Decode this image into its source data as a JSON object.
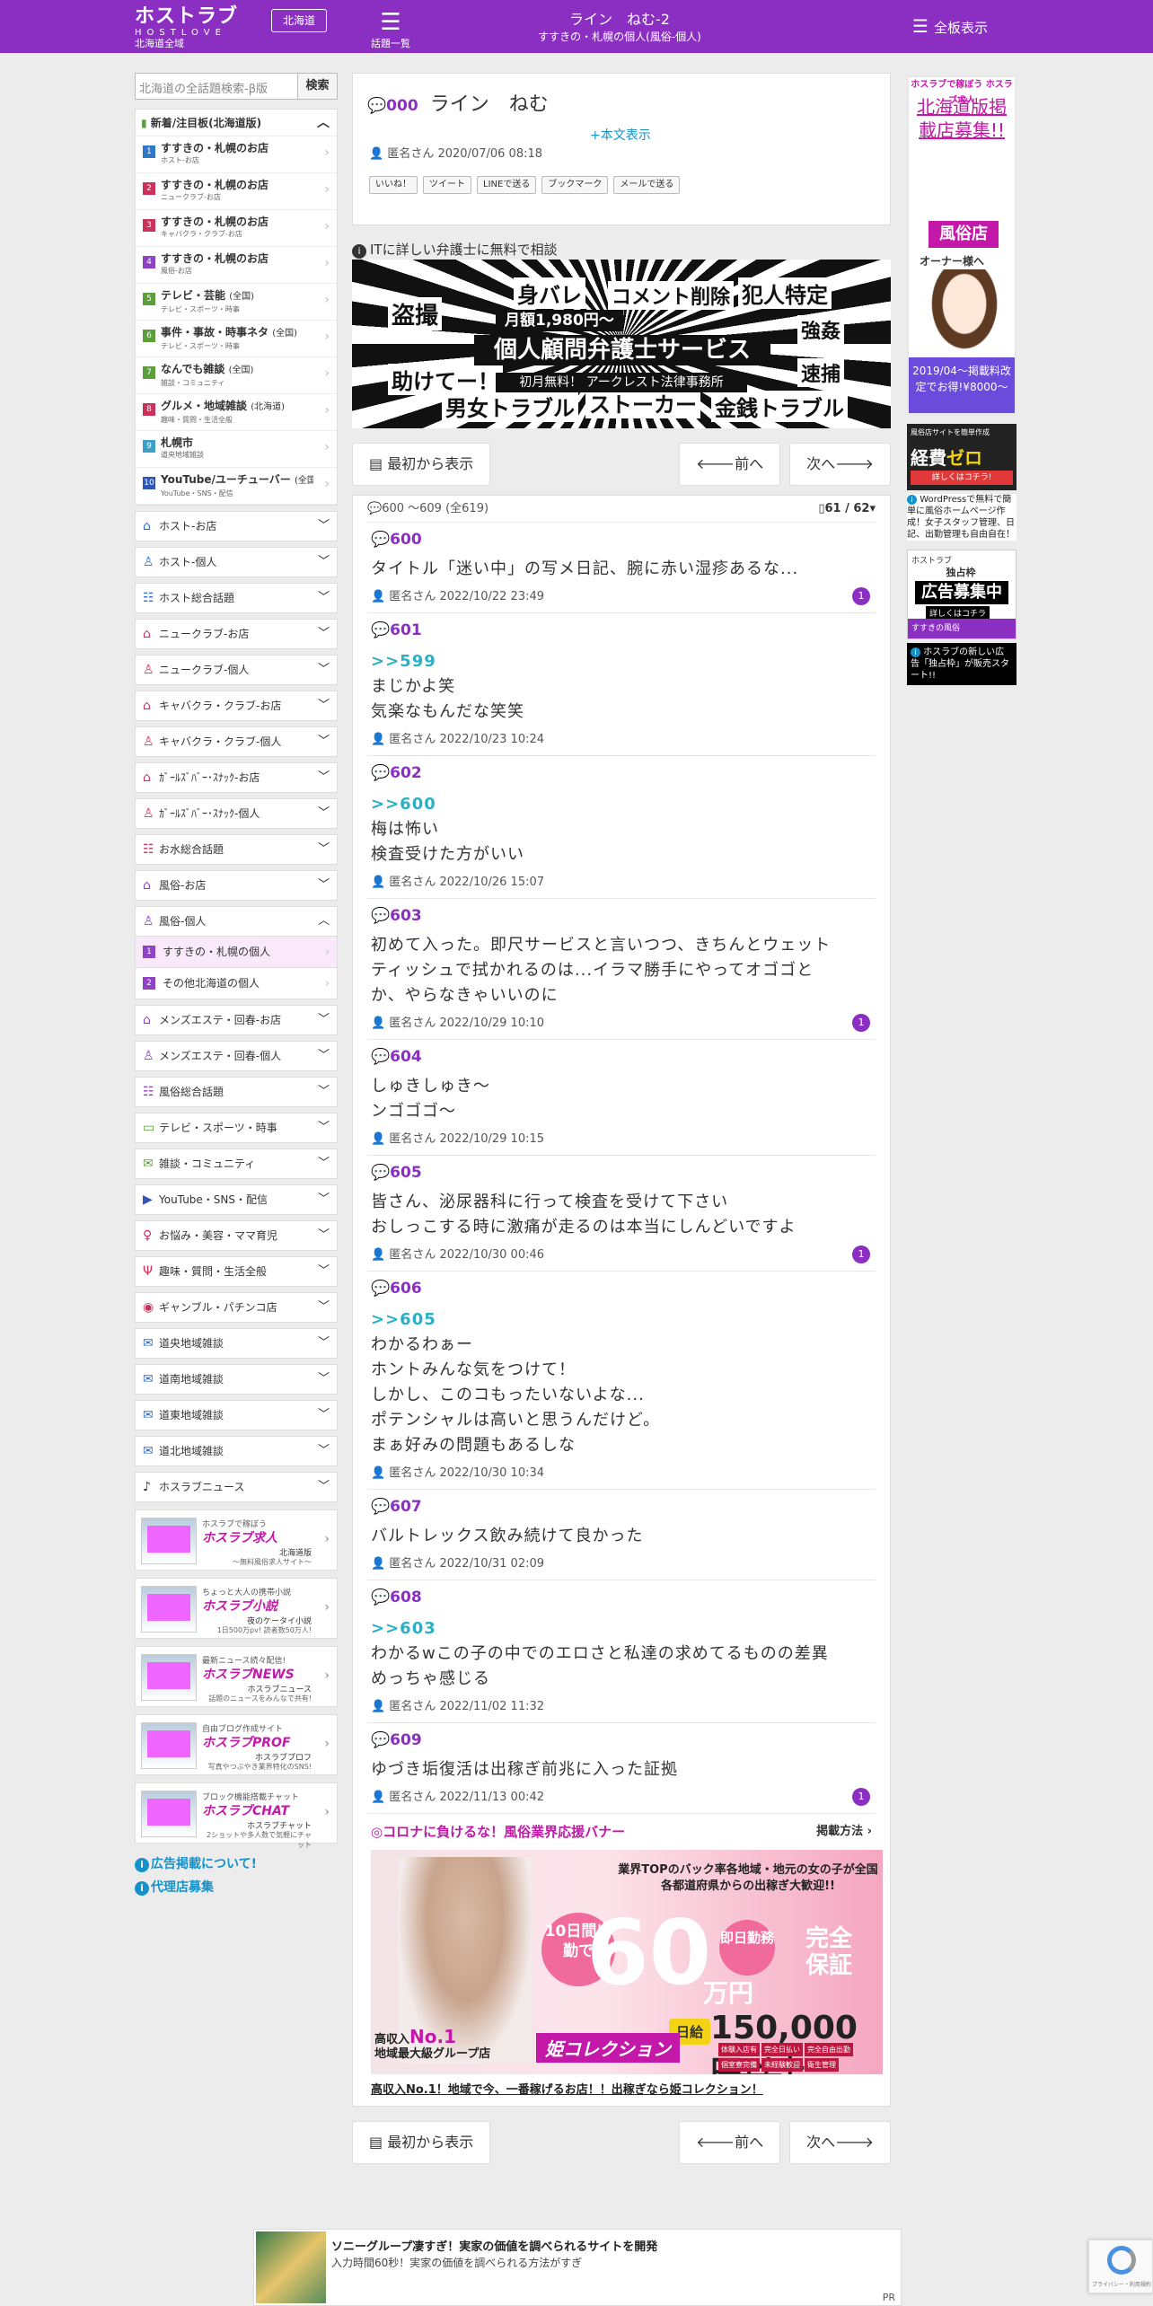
{
  "header": {
    "logo_main": "ホストラブ",
    "logo_sub": "HOSTLOVE",
    "logo_area": "北海道全域",
    "area_button": "北海道",
    "menu_icon_label": "話題一覧",
    "title": "ライン　ねむ-2",
    "subtitle": "すすきの・札幌の個人(風俗-個人)",
    "all_boards": "全板表示"
  },
  "sidebar": {
    "search_placeholder": "北海道の全話題検索-β版",
    "search_button": "検索",
    "new_boards_title": "新着/注目板(北海道版)",
    "boards": [
      {
        "num": "1",
        "color": "#3079c6",
        "title": "すすきの・札幌のお店",
        "small": "",
        "sub": "ホスト-お店"
      },
      {
        "num": "2",
        "color": "#c9335b",
        "title": "すすきの・札幌のお店",
        "small": "",
        "sub": "ニュークラブ-お店"
      },
      {
        "num": "3",
        "color": "#c9335b",
        "title": "すすきの・札幌のお店",
        "small": "",
        "sub": "キャバクラ・クラブ-お店"
      },
      {
        "num": "4",
        "color": "#8f42c4",
        "title": "すすきの・札幌のお店",
        "small": "",
        "sub": "風俗-お店"
      },
      {
        "num": "5",
        "color": "#5b9e3c",
        "title": "テレビ・芸能",
        "small": "(全国)",
        "sub": "テレビ・スポーツ・時事"
      },
      {
        "num": "6",
        "color": "#5b9e3c",
        "title": "事件・事故・時事ネタ",
        "small": "(全国)",
        "sub": "テレビ・スポーツ・時事"
      },
      {
        "num": "7",
        "color": "#5b9e3c",
        "title": "なんでも雑談",
        "small": "(全国)",
        "sub": "雑談・コミュニティ"
      },
      {
        "num": "8",
        "color": "#c9335b",
        "title": "グルメ・地域雑談",
        "small": "(北海道)",
        "sub": "趣味・質問・生活全般"
      },
      {
        "num": "9",
        "color": "#3aa1c9",
        "title": "札幌市",
        "small": "",
        "sub": "道央地域雑談"
      },
      {
        "num": "10",
        "color": "#3055b5",
        "title": "YouTube/ユーチューバー",
        "small": "(全国)",
        "sub": "YouTube・SNS・配信"
      }
    ],
    "categories": [
      {
        "icon": "⌂",
        "color": "#2b6ecb",
        "label": "ホスト-お店"
      },
      {
        "icon": "♙",
        "color": "#2b6ecb",
        "label": "ホスト-個人"
      },
      {
        "icon": "☷",
        "color": "#2b6ecb",
        "label": "ホスト総合話題"
      },
      {
        "icon": "⌂",
        "color": "#c9335b",
        "label": "ニュークラブ-お店"
      },
      {
        "icon": "♙",
        "color": "#c9335b",
        "label": "ニュークラブ-個人"
      },
      {
        "icon": "⌂",
        "color": "#c9335b",
        "label": "キャバクラ・クラブ-お店"
      },
      {
        "icon": "♙",
        "color": "#c9335b",
        "label": "キャバクラ・クラブ-個人"
      },
      {
        "icon": "⌂",
        "color": "#c9335b",
        "label": "ｶﾞｰﾙｽﾞﾊﾞｰ･ｽﾅｯｸ-お店"
      },
      {
        "icon": "♙",
        "color": "#c9335b",
        "label": "ｶﾞｰﾙｽﾞﾊﾞｰ･ｽﾅｯｸ-個人"
      },
      {
        "icon": "☷",
        "color": "#c9335b",
        "label": "お水総合話題"
      },
      {
        "icon": "⌂",
        "color": "#8f42c4",
        "label": "風俗-お店"
      }
    ],
    "active_category": {
      "icon": "♙",
      "color": "#8f42c4",
      "label": "風俗-個人"
    },
    "active_subs": [
      {
        "num": "1",
        "label": "すすきの・札幌の個人"
      },
      {
        "num": "2",
        "label": "その他北海道の個人"
      }
    ],
    "categories2": [
      {
        "icon": "⌂",
        "color": "#8f42c4",
        "label": "メンズエステ・回春-お店"
      },
      {
        "icon": "♙",
        "color": "#8f42c4",
        "label": "メンズエステ・回春-個人"
      },
      {
        "icon": "☷",
        "color": "#8f42c4",
        "label": "風俗総合話題"
      },
      {
        "icon": "▭",
        "color": "#5b9e3c",
        "label": "テレビ・スポーツ・時事"
      },
      {
        "icon": "✉",
        "color": "#5b9e3c",
        "label": "雑談・コミュニティ"
      },
      {
        "icon": "▶",
        "color": "#3055b5",
        "label": "YouTube・SNS・配信"
      },
      {
        "icon": "♀",
        "color": "#c9335b",
        "label": "お悩み・美容・ママ育児"
      },
      {
        "icon": "Ψ",
        "color": "#c9335b",
        "label": "趣味・質問・生活全般"
      },
      {
        "icon": "◉",
        "color": "#c9335b",
        "label": "ギャンブル・パチンコ店"
      },
      {
        "icon": "✉",
        "color": "#2b6ecb",
        "label": "道央地域雑談"
      },
      {
        "icon": "✉",
        "color": "#2b6ecb",
        "label": "道南地域雑談"
      },
      {
        "icon": "✉",
        "color": "#2b6ecb",
        "label": "道東地域雑談"
      },
      {
        "icon": "✉",
        "color": "#2b6ecb",
        "label": "道北地域雑談"
      },
      {
        "icon": "♪",
        "color": "#333333",
        "label": "ホスラブニュース"
      }
    ],
    "banners": [
      {
        "t1": "ホスラブで稼ぼう",
        "t2": "ホスラブ求人",
        "t3": "北海道版",
        "t4": "〜無料風俗求人サイト〜"
      },
      {
        "t1": "ちょっと大人の携帯小説",
        "t2": "ホスラブ小説",
        "t3": "夜のケータイ小説",
        "t4": "1日500万pv! 読者数50万人!"
      },
      {
        "t1": "最新ニュース続々配信!",
        "t2": "ホスラブNEWS",
        "t3": "ホスラブニュース",
        "t4": "話題のニュースをみんなで共有!"
      },
      {
        "t1": "自由ブログ作成サイト",
        "t2": "ホスラブPROF",
        "t3": "ホスラブプロフ",
        "t4": "写真やつぶやき業界特化のSNS!"
      },
      {
        "t1": "ブロック機能搭載チャット",
        "t2": "ホスラブCHAT",
        "t3": "ホスラブチャット",
        "t4": "2ショットや多人数で気軽にチャット"
      }
    ],
    "links": [
      "広告掲載について!",
      "代理店募集"
    ]
  },
  "thread": {
    "number": "000",
    "title": "ライン　ねむ",
    "show_body": "+本文表示",
    "author": "匿名さん",
    "date": "2020/07/06 08:18",
    "share": [
      "いいね！",
      "ツイート",
      "LINEで送る",
      "ブックマーク",
      "メールで送る"
    ]
  },
  "law_ad": {
    "heading": "ITに詳しい弁護士に無料で相談",
    "words": [
      "身バレ",
      "コメント削除",
      "犯人特定",
      "盗撮",
      "強姦",
      "速捕",
      "助けてー！",
      "男女トラブル",
      "ストーカー",
      "金銭トラブル"
    ],
    "price": "月額1,980円〜",
    "main": "個人顧問弁護士サービス",
    "free": "初月無料！ アークレスト法律事務所"
  },
  "nav": {
    "first": "最初から表示",
    "prev": "前へ",
    "next": "次へ"
  },
  "range": {
    "label": "600 ～609 (全619)",
    "page": "61 / 62"
  },
  "posts": [
    {
      "no": "600",
      "ref": "",
      "lines": [
        "タイトル「迷い中」の写メ日記、腕に赤い湿疹あるな..."
      ],
      "author": "匿名さん",
      "date": "2022/10/22 23:49",
      "count": "1"
    },
    {
      "no": "601",
      "ref": ">>599",
      "lines": [
        "まじかよ笑",
        "気楽なもんだな笑笑"
      ],
      "author": "匿名さん",
      "date": "2022/10/23 10:24",
      "count": ""
    },
    {
      "no": "602",
      "ref": ">>600",
      "lines": [
        "梅は怖い",
        "検査受けた方がいい"
      ],
      "author": "匿名さん",
      "date": "2022/10/26 15:07",
      "count": ""
    },
    {
      "no": "603",
      "ref": "",
      "lines": [
        "初めて入った。即尺サービスと言いつつ、きちんとウェット",
        "ティッシュで拭かれるのは...イラマ勝手にやってオゴゴと",
        "か、やらなきゃいいのに"
      ],
      "author": "匿名さん",
      "date": "2022/10/29 10:10",
      "count": "1"
    },
    {
      "no": "604",
      "ref": "",
      "lines": [
        "しゅきしゅき〜",
        "ンゴゴゴ〜"
      ],
      "author": "匿名さん",
      "date": "2022/10/29 10:15",
      "count": ""
    },
    {
      "no": "605",
      "ref": "",
      "lines": [
        "皆さん、泌尿器科に行って検査を受けて下さい",
        "おしっこする時に激痛が走るのは本当にしんどいですよ"
      ],
      "author": "匿名さん",
      "date": "2022/10/30 00:46",
      "count": "1"
    },
    {
      "no": "606",
      "ref": ">>605",
      "lines": [
        "わかるわぁー",
        "ホントみんな気をつけて！",
        "しかし、このコもったいないよな...",
        "ポテンシャルは高いと思うんだけど。",
        "まぁ好みの問題もあるしな"
      ],
      "author": "匿名さん",
      "date": "2022/10/30 10:34",
      "count": ""
    },
    {
      "no": "607",
      "ref": "",
      "lines": [
        "バルトレックス飲み続けて良かった"
      ],
      "author": "匿名さん",
      "date": "2022/10/31 02:09",
      "count": ""
    },
    {
      "no": "608",
      "ref": ">>603",
      "lines": [
        "わかるwこの子の中でのエロさと私達の求めてるものの差異",
        "めっちゃ感じる"
      ],
      "author": "匿名さん",
      "date": "2022/11/02 11:32",
      "count": ""
    },
    {
      "no": "609",
      "ref": "",
      "lines": [
        "ゆづき垢復活は出稼ぎ前兆に入った証拠"
      ],
      "author": "匿名さん",
      "date": "2022/11/13 00:42",
      "count": "1"
    }
  ],
  "pr": {
    "heading": "◎コロナに負けるな！風俗業界応援バナー",
    "method": "掲載方法 ›",
    "catch": "業界TOPのバック率各地域・地元の女の子が全国各都道府県からの出稼ぎ大歓迎!!",
    "days": "10日間出勤で",
    "sixty": "60",
    "sokujitsu": "即日勤務",
    "man": "万円",
    "hosyo": "完全保証",
    "nikkyu": "日給",
    "amount": "150,000円以上",
    "low1": "高収入",
    "low2": "No.1",
    "low3": "地域最大級グループ店",
    "brand": "姫コレクション",
    "tags": [
      "体験入店有",
      "完全日払い",
      "完全自由出勤",
      "個室寮完備",
      "未経験歓迎",
      "衛生管理",
      "プライバシー保護"
    ],
    "link": "高収入No.1！地域で今、一番稼げるお店！！出稼ぎなら姫コレクション！"
  },
  "right": {
    "ad1_top": "ホスラブで稼ぼう ホスラブ求人",
    "ad1_title": "北海道版掲載店募集!!",
    "ad1_tag": "風俗店",
    "ad1_owner": "オーナー様へ",
    "ad1_bottom": "2019/04〜掲載料改定でお得!¥8000〜",
    "ad2_top": "風俗店サイトを簡単作成",
    "ad2_main1": "経費",
    "ad2_main2": "ゼロ",
    "ad2_btn": "詳しくはコチラ!",
    "note1": "WordPressで無料で簡単に風俗ホームページ作成！女子スタッフ管理、日記、出勤管理も自由自在！",
    "ad3_top": "ホストラブ",
    "ad3_sub": "独占枠",
    "ad3_main": "広告募集中",
    "ad3_btn": "詳しくはコチラ",
    "ad3_bottom": "すすきの風俗",
    "note2": "ホスラブの新しい広告「独占枠」が販売スタート!!"
  },
  "bottom_ad": {
    "title": "ソニーグループ凄すぎ！実家の価値を調べられるサイトを開発",
    "desc": "入力時間60秒！実家の価値を調べられる方法がすぎ",
    "pr": "PR"
  },
  "recaptcha": "プライバシー・利用規約"
}
